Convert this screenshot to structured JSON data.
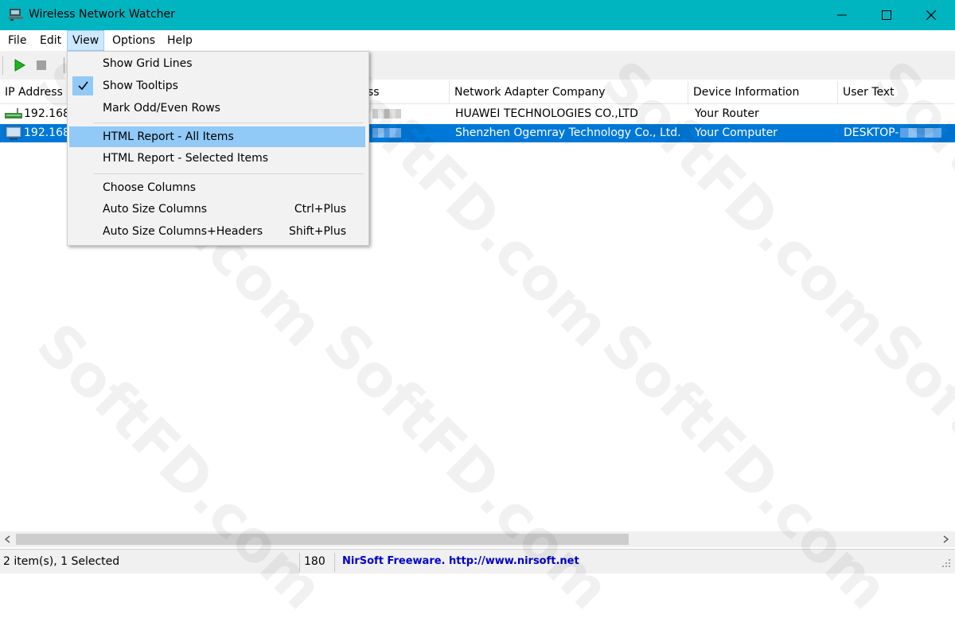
{
  "window": {
    "title": "Wireless Network Watcher",
    "accent": "#00b4c0"
  },
  "menubar": {
    "items": [
      "File",
      "Edit",
      "View",
      "Options",
      "Help"
    ],
    "open_menu": "View"
  },
  "view_menu": {
    "items": [
      {
        "label": "Show Grid Lines",
        "checked": false,
        "shortcut": ""
      },
      {
        "label": "Show Tooltips",
        "checked": true,
        "shortcut": ""
      },
      {
        "label": "Mark Odd/Even Rows",
        "checked": false,
        "shortcut": ""
      },
      {
        "label": "HTML Report - All Items",
        "highlighted": true,
        "shortcut": ""
      },
      {
        "label": "HTML Report - Selected Items",
        "shortcut": ""
      },
      {
        "label": "Choose Columns",
        "shortcut": ""
      },
      {
        "label": "Auto Size Columns",
        "shortcut": "Ctrl+Plus"
      },
      {
        "label": "Auto Size Columns+Headers",
        "shortcut": "Shift+Plus"
      }
    ]
  },
  "toolbar": {
    "icons": [
      "play-icon",
      "stop-icon"
    ]
  },
  "table": {
    "columns": [
      "IP Address",
      "ss",
      "Network Adapter Company",
      "Device Information",
      "User Text"
    ],
    "rows": [
      {
        "ip": "192.168.",
        "company": "HUAWEI TECHNOLOGIES CO.,LTD",
        "device": "Your Router",
        "user_text": "",
        "selected": false
      },
      {
        "ip": "192.168.",
        "company": "Shenzhen Ogemray Technology Co., Ltd.",
        "device": "Your Computer",
        "user_text": "DESKTOP-",
        "selected": true
      }
    ],
    "selection_color": "#0078d7"
  },
  "statusbar": {
    "count": "2 item(s), 1 Selected",
    "number": "180",
    "nirsoft": "NirSoft Freeware.  http://www.nirsoft.net"
  },
  "watermark": "SoftFD.com"
}
